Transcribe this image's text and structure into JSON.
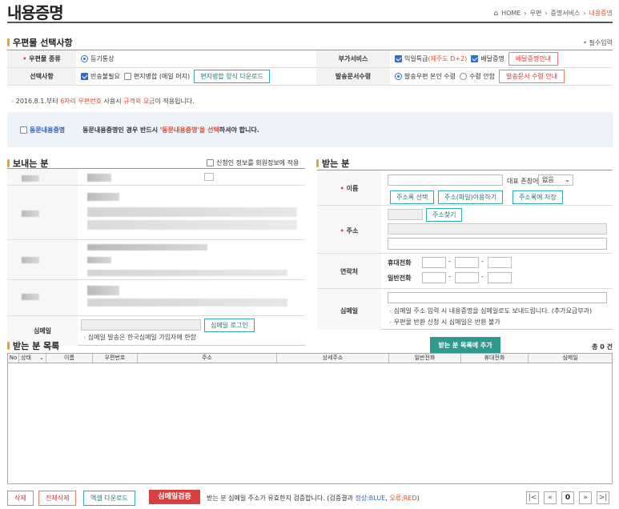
{
  "page": {
    "title": "내용증명"
  },
  "breadcrumb": [
    "HOME",
    "우편",
    "증명서비스",
    "내용증명"
  ],
  "options_section": {
    "title": "우편물 선택사항",
    "required_note": "필수입력",
    "row1": {
      "label": "우편물 종류",
      "value": "등기통상",
      "extra_label": "부가서비스",
      "opt1": "익일특급",
      "opt1_note": "(제주도 D+2)",
      "opt2": "배달증명",
      "btn": "배달증명안내"
    },
    "row2": {
      "label": "선택사항",
      "opt1": "반송불필요",
      "opt2": "편지병합 (메일 머지)",
      "btn": "편지병합 양식 다운로드",
      "extra_label": "발송문서수령",
      "radio1": "발송우편 본인 수령",
      "radio2": "수령 안함",
      "btn2": "발송문서 수령 안내"
    }
  },
  "notice": {
    "prefix": "2016.8.1.부터 ",
    "hl1": "6자리 우편번호",
    "mid": " 사용시 ",
    "hl2": "규격외 요금",
    "suffix": "이 적용됩니다."
  },
  "same_content": {
    "label": "동문내용증명",
    "text_prefix": "동문내용증명인 경우 반드시 '",
    "text_hl": "동문내용증명'을 선택",
    "text_suffix": "하셔야 합니다."
  },
  "sender": {
    "title": "보내는 분",
    "apply_label": "신청인 정보를 회원정보에 적용",
    "email_label": "심메일",
    "email_btn": "심메일 로그인",
    "email_note": "심메일 발송은 한국심메일 가입자에 한함"
  },
  "receiver": {
    "title": "받는 분",
    "name_label": "이름",
    "title_label": "대표 존칭어",
    "title_value": "없음",
    "btn_addr_select": "주소록 선택",
    "btn_file": "주소(파일)이용하기",
    "btn_addr_save": "주소록에 저장",
    "addr_label": "주소",
    "btn_find_addr": "주소찾기",
    "contact_label": "연락처",
    "mobile_label": "휴대전화",
    "phone_label": "일반전화",
    "email_label": "심메일",
    "email_note1": "심메일 주소 입력 시 내용증명을 심메일로도 보내드립니다. (추가요금부과)",
    "email_note2": "우편물 반환 신청 시 심메일은 반환 불가",
    "add_btn": "받는 분 목록에 추가"
  },
  "list": {
    "title": "받는 분 목록",
    "total": "총 0 건",
    "columns": [
      "No",
      "상태",
      "이름",
      "우편번호",
      "주소",
      "상세주소",
      "일반전화",
      "휴대전화",
      "심메일"
    ]
  },
  "footer": {
    "btn_delete": "삭제",
    "btn_delete_all": "전체삭제",
    "btn_excel": "액셀 다운로드",
    "btn_verify": "심메일검증",
    "verify_prefix": "받는 분 심메일 주소가 유효한지 검증합니다. (검증결과 ",
    "verify_ok": "정상:BLUE",
    "verify_sep": ", ",
    "verify_err": "오류:RED",
    "verify_suffix": ")",
    "page": "0"
  }
}
